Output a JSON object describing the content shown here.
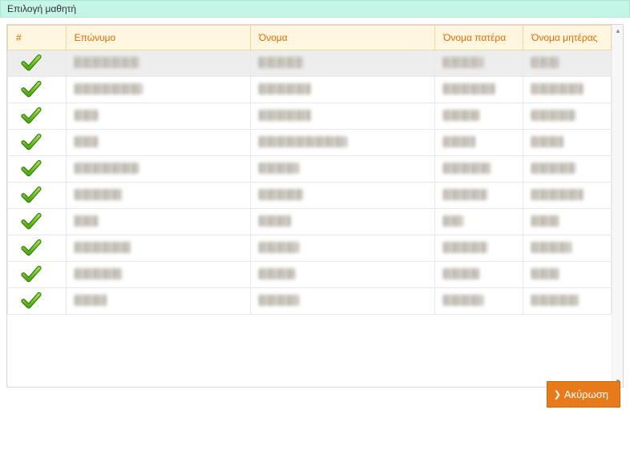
{
  "title_bar": {
    "text": "Επιλογή μαθητή"
  },
  "table": {
    "columns": {
      "number": "#",
      "surname": "Επώνυμο",
      "name": "Όνομα",
      "father": "Όνομα πατέρα",
      "mother": "Όνομα μητέρας"
    },
    "rows": [
      {
        "checked": true,
        "selected": true,
        "surname_w": 80,
        "name_w": 55,
        "father_w": 50,
        "mother_w": 35
      },
      {
        "checked": true,
        "selected": false,
        "surname_w": 85,
        "name_w": 65,
        "father_w": 65,
        "mother_w": 65
      },
      {
        "checked": true,
        "selected": false,
        "surname_w": 30,
        "name_w": 65,
        "father_w": 45,
        "mother_w": 55
      },
      {
        "checked": true,
        "selected": false,
        "surname_w": 30,
        "name_w": 110,
        "father_w": 40,
        "mother_w": 40
      },
      {
        "checked": true,
        "selected": false,
        "surname_w": 80,
        "name_w": 50,
        "father_w": 60,
        "mother_w": 55
      },
      {
        "checked": true,
        "selected": false,
        "surname_w": 60,
        "name_w": 55,
        "father_w": 55,
        "mother_w": 65
      },
      {
        "checked": true,
        "selected": false,
        "surname_w": 30,
        "name_w": 40,
        "father_w": 25,
        "mother_w": 35
      },
      {
        "checked": true,
        "selected": false,
        "surname_w": 70,
        "name_w": 50,
        "father_w": 55,
        "mother_w": 50
      },
      {
        "checked": true,
        "selected": false,
        "surname_w": 60,
        "name_w": 45,
        "father_w": 45,
        "mother_w": 35
      },
      {
        "checked": true,
        "selected": false,
        "surname_w": 40,
        "name_w": 50,
        "father_w": 50,
        "mother_w": 60
      }
    ]
  },
  "footer": {
    "cancel_label": "Ακύρωση"
  }
}
